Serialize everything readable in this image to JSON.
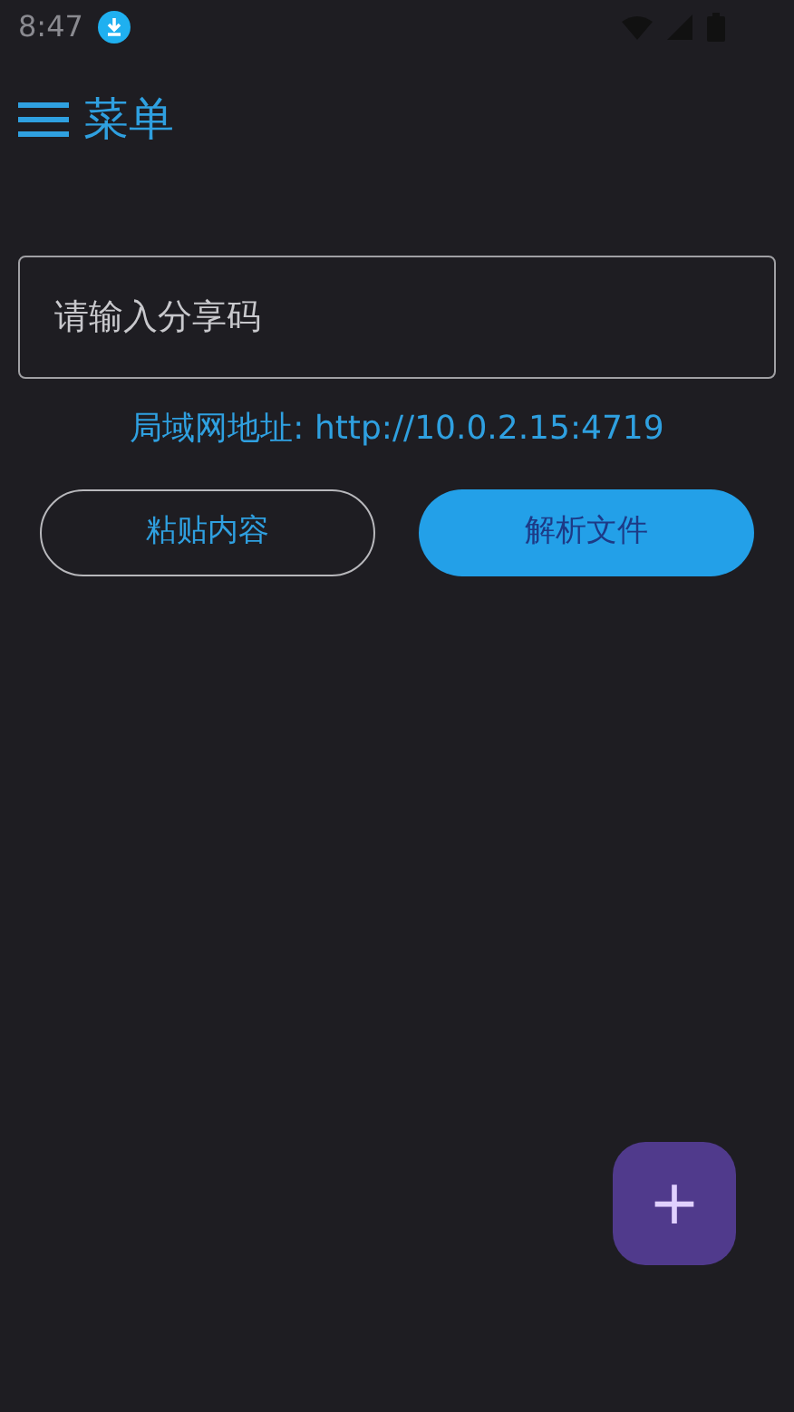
{
  "status_bar": {
    "time": "8:47"
  },
  "toolbar": {
    "title": "菜单"
  },
  "share_code_field": {
    "placeholder": "请输入分享码"
  },
  "lan_address": "局域网地址: http://10.0.2.15:4719",
  "buttons": [
    {
      "label": "粘贴内容",
      "kind": "outline"
    },
    {
      "label": "解析文件",
      "kind": "filled"
    }
  ],
  "fab": {
    "label": "+"
  }
}
